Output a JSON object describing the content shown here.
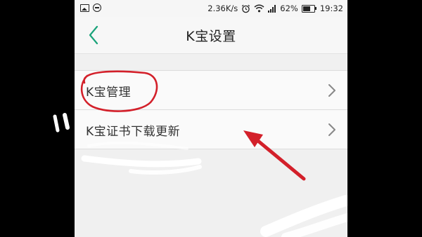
{
  "status_bar": {
    "net_speed": "2.36K/s",
    "battery": "62%",
    "time": "19:32",
    "icons": [
      "image-icon",
      "do-not-disturb-icon",
      "alarm-icon",
      "wifi-icon",
      "signal-icon",
      "battery-icon"
    ]
  },
  "header": {
    "title": "K宝设置",
    "back_icon": "back-chevron-icon"
  },
  "list": {
    "items": [
      {
        "label": "K宝管理"
      },
      {
        "label": "K宝证书下载更新"
      }
    ],
    "chevron_icon": "chevron-right-icon"
  },
  "colors": {
    "accent": "#1aa37a",
    "annotation": "#d3202a",
    "background": "#f0f0f0"
  }
}
